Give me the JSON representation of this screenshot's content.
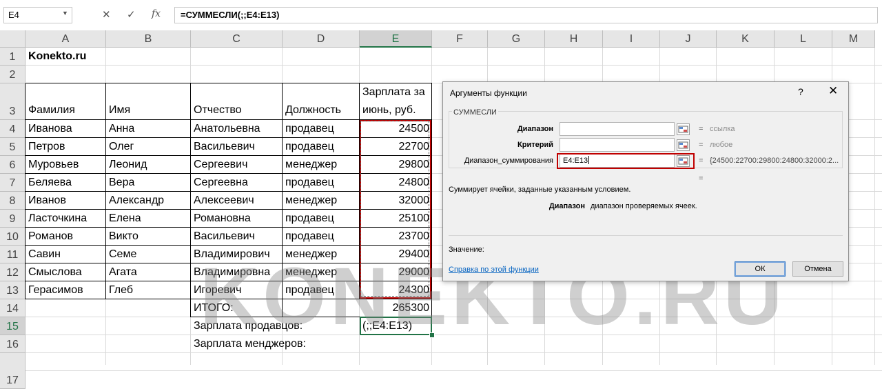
{
  "formula_bar": {
    "namebox": "E4",
    "cancel_icon": "✕",
    "enter_icon": "✓",
    "fx_icon": "fx",
    "formula": "=СУММЕСЛИ(;;E4:E13)"
  },
  "columns": [
    "A",
    "B",
    "C",
    "D",
    "E",
    "F",
    "G",
    "H",
    "I",
    "J",
    "K",
    "L",
    "M"
  ],
  "rows": [
    "1",
    "2",
    "3",
    "4",
    "5",
    "6",
    "7",
    "8",
    "9",
    "10",
    "11",
    "12",
    "13",
    "14",
    "15",
    "16",
    "17"
  ],
  "sheet": {
    "title": "Konekto.ru",
    "headers": {
      "surname": "Фамилия",
      "name": "Имя",
      "patronymic": "Отчество",
      "position": "Должность",
      "salary_line1": "Зарплата за",
      "salary_line2": "июнь, руб."
    },
    "data": [
      [
        "Иванова",
        "Анна",
        "Анатольевна",
        "продавец",
        "24500"
      ],
      [
        "Петров",
        "Олег",
        "Васильевич",
        "продавец",
        "22700"
      ],
      [
        "Муровьев",
        "Леонид",
        "Сергеевич",
        "менеджер",
        "29800"
      ],
      [
        "Беляева",
        "Вера",
        "Сергеевна",
        "продавец",
        "24800"
      ],
      [
        "Иванов",
        "Александр",
        "Алексеевич",
        "менеджер",
        "32000"
      ],
      [
        "Ласточкина",
        "Елена",
        "Романовна",
        "продавец",
        "25100"
      ],
      [
        "Романов",
        "Викто",
        "Васильевич",
        "продавец",
        "23700"
      ],
      [
        "Савин",
        "Семе",
        "Владимирович",
        "менеджер",
        "29400"
      ],
      [
        "Смыслова",
        "Агата",
        "Владимировна",
        "менеджер",
        "29000"
      ],
      [
        "Герасимов",
        "Глеб",
        "Игоревич",
        "продавец",
        "24300"
      ]
    ],
    "total_label": "ИТОГО:",
    "total_value": "265300",
    "sellers_label": "Зарплата продавцов:",
    "sellers_value": "(;;E4:E13)",
    "managers_label": "Зарплата менджеров:"
  },
  "watermark": "KONEKTO.RU",
  "dialog": {
    "title": "Аргументы функции",
    "help": "?",
    "close": "✕",
    "function_name": "СУММЕСЛИ",
    "args": [
      {
        "label": "Диапазон",
        "value": "",
        "hint": "ссылка"
      },
      {
        "label": "Критерий",
        "value": "",
        "hint": "любое"
      },
      {
        "label": "Диапазон_суммирования",
        "value": "E4:E13",
        "hint": "{24500:22700:29800:24800:32000:2..."
      }
    ],
    "equals": "=",
    "description": "Суммирует ячейки, заданные указанным условием.",
    "arg_name": "Диапазон",
    "arg_description": "диапазон проверяемых ячеек.",
    "value_label": "Значение:",
    "help_link": "Справка по этой функции",
    "ok": "ОК",
    "cancel": "Отмена"
  }
}
